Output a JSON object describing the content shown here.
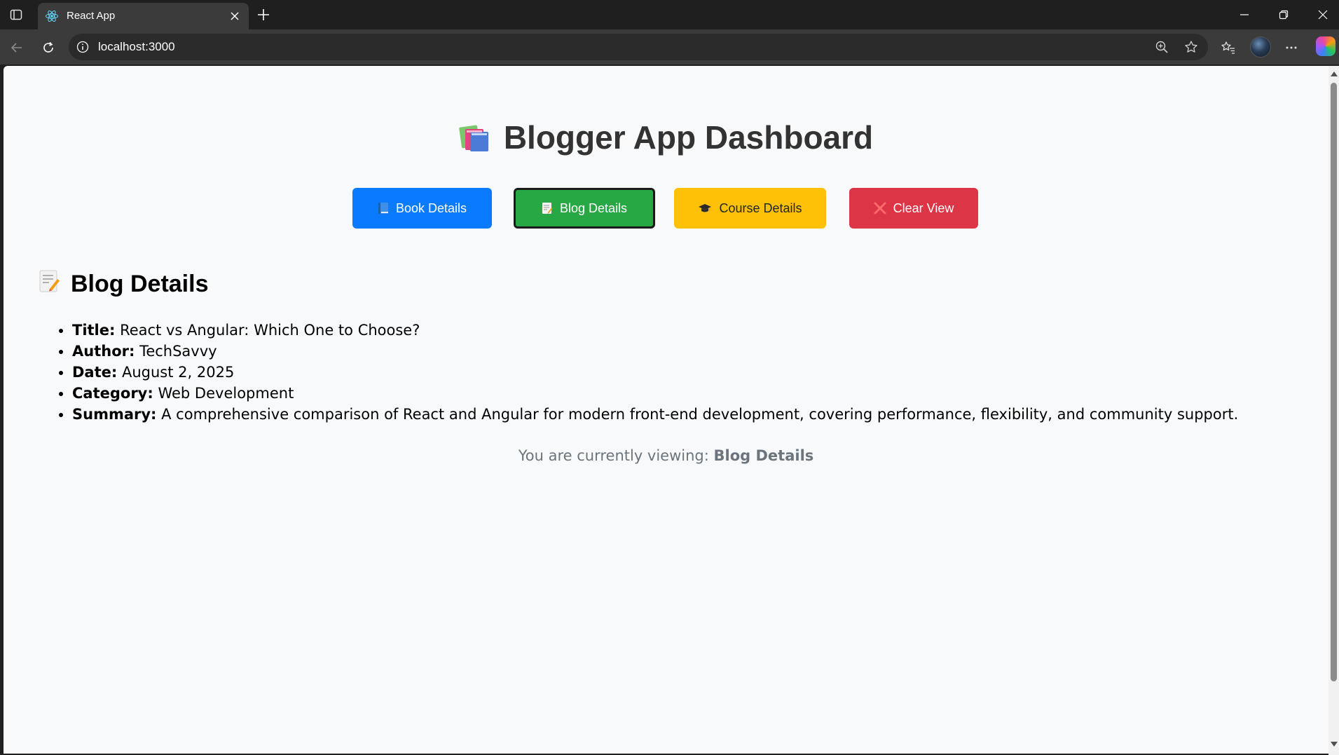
{
  "browser": {
    "tab_title": "React App",
    "url": "localhost:3000"
  },
  "page": {
    "title": "Blogger App Dashboard",
    "buttons": {
      "book": "Book Details",
      "blog": "Blog Details",
      "course": "Course Details",
      "clear": "Clear View"
    },
    "active_view": "Blog Details",
    "section_title": "Blog Details",
    "details": [
      {
        "label": "Title:",
        "value": "React vs Angular: Which One to Choose?"
      },
      {
        "label": "Author:",
        "value": "TechSavvy"
      },
      {
        "label": "Date:",
        "value": "August 2, 2025"
      },
      {
        "label": "Category:",
        "value": "Web Development"
      },
      {
        "label": "Summary:",
        "value": "A comprehensive comparison of React and Angular for modern front-end development, covering performance, flexibility, and community support."
      }
    ],
    "viewing_prefix": "You are currently viewing:",
    "viewing_value": "Blog Details"
  },
  "colors": {
    "book_button": "#0a7bff",
    "blog_button": "#28a745",
    "course_button": "#ffc107",
    "clear_button": "#dc3545",
    "page_background": "#f8f9fa"
  },
  "icons": {
    "title": "books-icon",
    "book_button": "blue-book-icon",
    "blog_button": "memo-icon",
    "course_button": "graduation-cap-icon",
    "clear_button": "cross-mark-icon",
    "section": "memo-icon"
  }
}
